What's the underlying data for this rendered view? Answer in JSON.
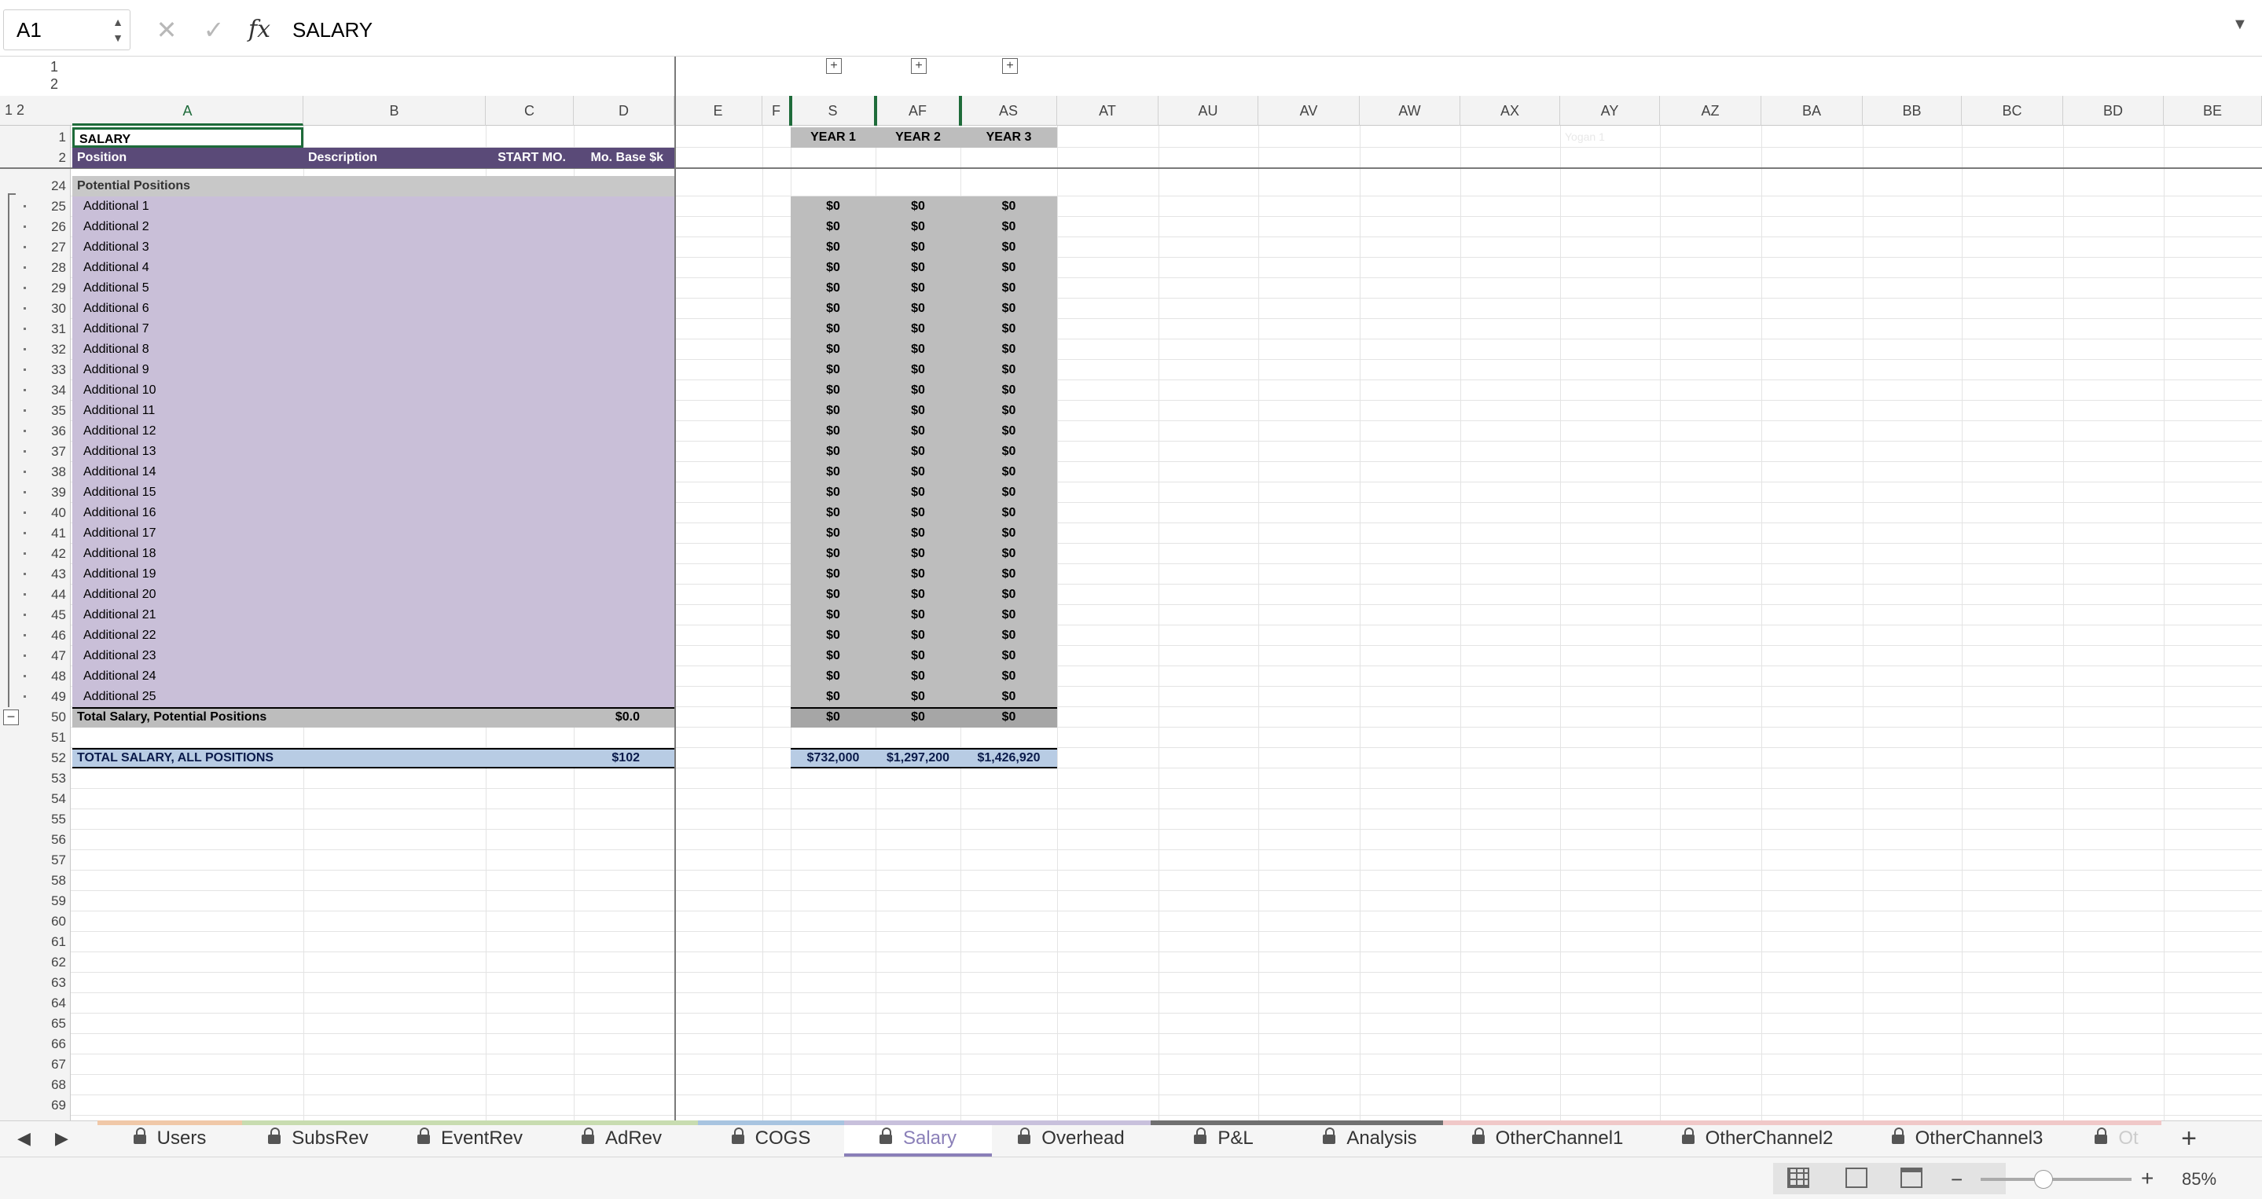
{
  "formula_bar": {
    "cell_ref": "A1",
    "content": "SALARY",
    "fx": "fx"
  },
  "outline": {
    "levels": [
      "1",
      "2"
    ],
    "col_levels": [
      "1",
      "2"
    ]
  },
  "columns": [
    "A",
    "B",
    "C",
    "D",
    "E",
    "F",
    "S",
    "AF",
    "AS",
    "AT",
    "AU",
    "AV",
    "AW",
    "AX",
    "AY",
    "AZ",
    "BA",
    "BB",
    "BC",
    "BD",
    "BE"
  ],
  "sheet": {
    "title": "SALARY",
    "headers": {
      "position": "Position",
      "description": "Description",
      "start": "START MO.",
      "base": "Mo. Base $k"
    },
    "year_headers": [
      "YEAR 1",
      "YEAR 2",
      "YEAR 3"
    ],
    "faint_text": "Yogan 1",
    "section_label": "Potential Positions",
    "rows": [
      {
        "num": "25",
        "label": "Additional 1"
      },
      {
        "num": "26",
        "label": "Additional 2"
      },
      {
        "num": "27",
        "label": "Additional 3"
      },
      {
        "num": "28",
        "label": "Additional 4"
      },
      {
        "num": "29",
        "label": "Additional 5"
      },
      {
        "num": "30",
        "label": "Additional 6"
      },
      {
        "num": "31",
        "label": "Additional 7"
      },
      {
        "num": "32",
        "label": "Additional 8"
      },
      {
        "num": "33",
        "label": "Additional 9"
      },
      {
        "num": "34",
        "label": "Additional 10"
      },
      {
        "num": "35",
        "label": "Additional 11"
      },
      {
        "num": "36",
        "label": "Additional 12"
      },
      {
        "num": "37",
        "label": "Additional 13"
      },
      {
        "num": "38",
        "label": "Additional 14"
      },
      {
        "num": "39",
        "label": "Additional 15"
      },
      {
        "num": "40",
        "label": "Additional 16"
      },
      {
        "num": "41",
        "label": "Additional 17"
      },
      {
        "num": "42",
        "label": "Additional 18"
      },
      {
        "num": "43",
        "label": "Additional 19"
      },
      {
        "num": "44",
        "label": "Additional 20"
      },
      {
        "num": "45",
        "label": "Additional 21"
      },
      {
        "num": "46",
        "label": "Additional 22"
      },
      {
        "num": "47",
        "label": "Additional 23"
      },
      {
        "num": "48",
        "label": "Additional 24"
      },
      {
        "num": "49",
        "label": "Additional 25"
      }
    ],
    "zero_value": "$0",
    "total_potential": {
      "label": "Total Salary, Potential Positions",
      "base": "$0.0",
      "years": [
        "$0",
        "$0",
        "$0"
      ]
    },
    "total_all": {
      "label": "TOTAL SALARY, ALL POSITIONS",
      "base": "$102",
      "years": [
        "$732,000",
        "$1,297,200",
        "$1,426,920"
      ]
    },
    "empty_rows": [
      "51",
      "53",
      "54",
      "55",
      "56",
      "57",
      "58",
      "59",
      "60",
      "61",
      "62",
      "63",
      "64",
      "65",
      "66",
      "67",
      "68",
      "69"
    ]
  },
  "tabs": [
    {
      "label": "Users",
      "color": "#f0c8a8"
    },
    {
      "label": "SubsRev",
      "color": "#c8dcb0"
    },
    {
      "label": "EventRev",
      "color": "#c8dcb0"
    },
    {
      "label": "AdRev",
      "color": "#c8dcb0"
    },
    {
      "label": "COGS",
      "color": "#a8c4e0"
    },
    {
      "label": "Salary",
      "color": "#c8c0dc",
      "active": true
    },
    {
      "label": "Overhead",
      "color": "#c8c0dc"
    },
    {
      "label": "P&L",
      "color": "#707070"
    },
    {
      "label": "Analysis",
      "color": "#707070"
    },
    {
      "label": "OtherChannel1",
      "color": "#f0c8c8"
    },
    {
      "label": "OtherChannel2",
      "color": "#f0c8c8"
    },
    {
      "label": "OtherChannel3",
      "color": "#f0c8c8"
    },
    {
      "label": "Ot",
      "color": "#f0c8c8"
    }
  ],
  "status": {
    "zoom": "85%"
  },
  "colors": {
    "header_purple": "#5a4a78",
    "light_purple": "#c9bfd8",
    "gray": "#bdbdbd",
    "total_blue": "#b8cce4",
    "select_green": "#1e6b3a"
  }
}
